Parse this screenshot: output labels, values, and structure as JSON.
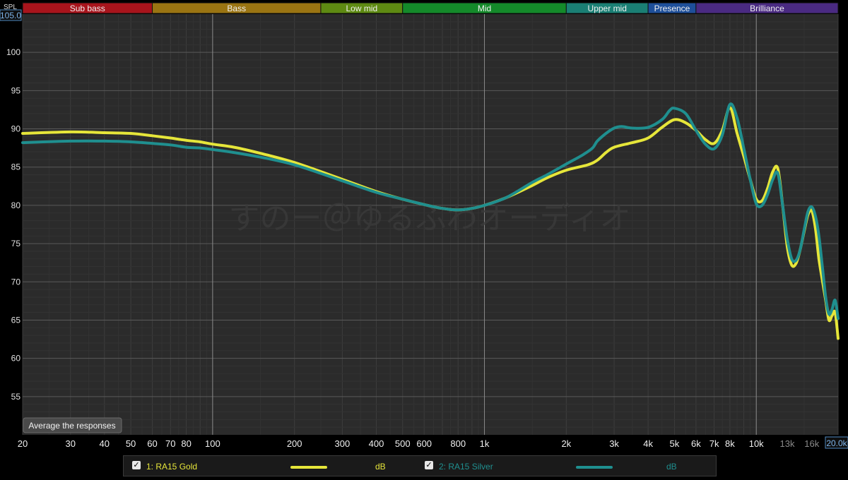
{
  "app": {
    "spl_label": "SPL",
    "y_max_label": "105.0",
    "x_max_label": "20.0k",
    "watermark": "すのー＠ゆるふわオーディオ",
    "average_button": "Average the responses"
  },
  "bands": [
    {
      "name": "Sub bass",
      "from": 20,
      "to": 60,
      "color": "#a8141c"
    },
    {
      "name": "Bass",
      "from": 60,
      "to": 250,
      "color": "#9a7412"
    },
    {
      "name": "Low mid",
      "from": 250,
      "to": 500,
      "color": "#5e8a12"
    },
    {
      "name": "Mid",
      "from": 500,
      "to": 2000,
      "color": "#148a2a"
    },
    {
      "name": "Upper mid",
      "from": 2000,
      "to": 4000,
      "color": "#1a7f74"
    },
    {
      "name": "Presence",
      "from": 4000,
      "to": 6000,
      "color": "#1e4f9a"
    },
    {
      "name": "Brilliance",
      "from": 6000,
      "to": 20000,
      "color": "#4a2a82"
    }
  ],
  "legend": [
    {
      "check": "✓",
      "name": "1: RA15 Gold",
      "unit": "dB",
      "color": "#e6e63a"
    },
    {
      "check": "✓",
      "name": "2: RA15 Silver",
      "unit": "dB",
      "color": "#1f8f8f"
    }
  ],
  "chart_data": {
    "type": "line",
    "x_scale": "log",
    "xlim": [
      20,
      20000
    ],
    "ylim": [
      50,
      105
    ],
    "grid": true,
    "xlabel": "",
    "ylabel": "SPL",
    "x_ticks": [
      {
        "v": 20,
        "label": "20"
      },
      {
        "v": 30,
        "label": "30"
      },
      {
        "v": 40,
        "label": "40"
      },
      {
        "v": 50,
        "label": "50"
      },
      {
        "v": 60,
        "label": "60"
      },
      {
        "v": 70,
        "label": "70"
      },
      {
        "v": 80,
        "label": "80"
      },
      {
        "v": 100,
        "label": "100"
      },
      {
        "v": 200,
        "label": "200"
      },
      {
        "v": 300,
        "label": "300"
      },
      {
        "v": 400,
        "label": "400"
      },
      {
        "v": 500,
        "label": "500"
      },
      {
        "v": 600,
        "label": "600"
      },
      {
        "v": 800,
        "label": "800"
      },
      {
        "v": 1000,
        "label": "1k"
      },
      {
        "v": 2000,
        "label": "2k"
      },
      {
        "v": 3000,
        "label": "3k"
      },
      {
        "v": 4000,
        "label": "4k"
      },
      {
        "v": 5000,
        "label": "5k"
      },
      {
        "v": 6000,
        "label": "6k"
      },
      {
        "v": 7000,
        "label": "7k"
      },
      {
        "v": 8000,
        "label": "8k"
      },
      {
        "v": 10000,
        "label": "10k"
      },
      {
        "v": 13000,
        "label": "13k"
      },
      {
        "v": 16000,
        "label": "16k"
      }
    ],
    "y_ticks": [
      55,
      60,
      65,
      70,
      75,
      80,
      85,
      90,
      95,
      100
    ],
    "series": [
      {
        "name": "1: RA15 Gold",
        "color": "#e6e63a",
        "points": [
          [
            20,
            89.4
          ],
          [
            30,
            89.6
          ],
          [
            40,
            89.5
          ],
          [
            50,
            89.4
          ],
          [
            60,
            89.1
          ],
          [
            70,
            88.8
          ],
          [
            80,
            88.5
          ],
          [
            90,
            88.3
          ],
          [
            100,
            88.0
          ],
          [
            120,
            87.6
          ],
          [
            150,
            86.8
          ],
          [
            200,
            85.6
          ],
          [
            300,
            83.4
          ],
          [
            400,
            81.8
          ],
          [
            500,
            80.8
          ],
          [
            600,
            80.1
          ],
          [
            700,
            79.6
          ],
          [
            800,
            79.4
          ],
          [
            900,
            79.6
          ],
          [
            1000,
            80.0
          ],
          [
            1200,
            81.0
          ],
          [
            1500,
            82.6
          ],
          [
            1700,
            83.6
          ],
          [
            2000,
            84.6
          ],
          [
            2400,
            85.3
          ],
          [
            2600,
            85.9
          ],
          [
            2800,
            86.9
          ],
          [
            3000,
            87.6
          ],
          [
            3500,
            88.2
          ],
          [
            4000,
            88.8
          ],
          [
            4500,
            90.2
          ],
          [
            5000,
            91.2
          ],
          [
            5500,
            90.8
          ],
          [
            6000,
            89.8
          ],
          [
            6500,
            88.6
          ],
          [
            7000,
            88.1
          ],
          [
            7500,
            89.8
          ],
          [
            8000,
            92.8
          ],
          [
            8500,
            89.4
          ],
          [
            9000,
            86.4
          ],
          [
            9500,
            83.4
          ],
          [
            10000,
            80.8
          ],
          [
            10500,
            80.6
          ],
          [
            11000,
            82.2
          ],
          [
            11500,
            84.4
          ],
          [
            12000,
            84.8
          ],
          [
            12500,
            80.0
          ],
          [
            13000,
            74.6
          ],
          [
            13500,
            72.2
          ],
          [
            14000,
            72.4
          ],
          [
            14500,
            74.2
          ],
          [
            15000,
            76.6
          ],
          [
            15500,
            78.8
          ],
          [
            16000,
            79.3
          ],
          [
            16500,
            77.0
          ],
          [
            17000,
            73.0
          ],
          [
            17500,
            70.2
          ],
          [
            18000,
            67.6
          ],
          [
            18500,
            65.0
          ],
          [
            19000,
            65.6
          ],
          [
            19500,
            66.0
          ],
          [
            20000,
            62.6
          ]
        ]
      },
      {
        "name": "2: RA15 Silver",
        "color": "#1f8f8f",
        "points": [
          [
            20,
            88.2
          ],
          [
            30,
            88.4
          ],
          [
            40,
            88.4
          ],
          [
            50,
            88.3
          ],
          [
            60,
            88.1
          ],
          [
            70,
            87.9
          ],
          [
            80,
            87.6
          ],
          [
            90,
            87.5
          ],
          [
            100,
            87.3
          ],
          [
            120,
            86.9
          ],
          [
            150,
            86.3
          ],
          [
            200,
            85.3
          ],
          [
            300,
            83.2
          ],
          [
            400,
            81.7
          ],
          [
            500,
            80.8
          ],
          [
            600,
            80.1
          ],
          [
            700,
            79.6
          ],
          [
            800,
            79.4
          ],
          [
            900,
            79.6
          ],
          [
            1000,
            80.0
          ],
          [
            1200,
            81.0
          ],
          [
            1500,
            83.0
          ],
          [
            1700,
            84.0
          ],
          [
            2000,
            85.4
          ],
          [
            2300,
            86.6
          ],
          [
            2500,
            87.5
          ],
          [
            2600,
            88.4
          ],
          [
            2800,
            89.4
          ],
          [
            3000,
            90.1
          ],
          [
            3200,
            90.3
          ],
          [
            3500,
            90.1
          ],
          [
            4000,
            90.2
          ],
          [
            4500,
            91.2
          ],
          [
            4800,
            92.4
          ],
          [
            5000,
            92.7
          ],
          [
            5500,
            92.0
          ],
          [
            6000,
            89.8
          ],
          [
            6500,
            88.0
          ],
          [
            7000,
            87.4
          ],
          [
            7500,
            89.2
          ],
          [
            8000,
            93.2
          ],
          [
            8500,
            91.4
          ],
          [
            9000,
            87.4
          ],
          [
            9500,
            83.4
          ],
          [
            10000,
            80.2
          ],
          [
            10500,
            80.0
          ],
          [
            11000,
            81.4
          ],
          [
            11500,
            83.4
          ],
          [
            12000,
            84.2
          ],
          [
            12500,
            80.0
          ],
          [
            13000,
            75.6
          ],
          [
            13500,
            73.0
          ],
          [
            14000,
            72.8
          ],
          [
            14500,
            74.2
          ],
          [
            15000,
            76.8
          ],
          [
            15500,
            79.2
          ],
          [
            16000,
            79.8
          ],
          [
            16500,
            78.6
          ],
          [
            17000,
            76.0
          ],
          [
            17500,
            72.0
          ],
          [
            18000,
            68.0
          ],
          [
            18500,
            65.8
          ],
          [
            19000,
            66.4
          ],
          [
            19500,
            67.6
          ],
          [
            20000,
            65.2
          ]
        ]
      }
    ]
  }
}
